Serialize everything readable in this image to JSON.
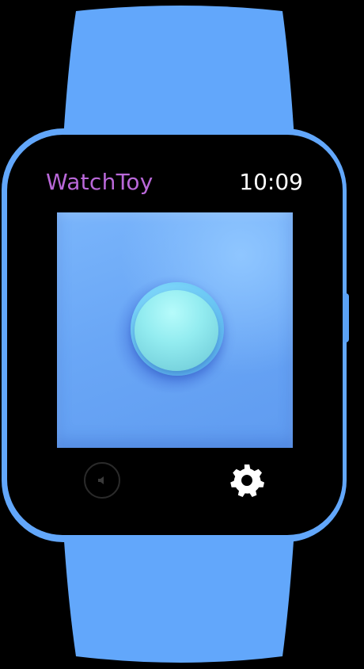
{
  "app": {
    "title": "WatchToy",
    "time": "10:09"
  },
  "colors": {
    "band": "#62a7fb",
    "title": "#b968d8",
    "screen_bg": "#000000",
    "play_area": "#6eabf7",
    "toy_button": "#93ecf0"
  },
  "icons": {
    "sound": "speaker-icon",
    "settings": "gear-icon"
  }
}
